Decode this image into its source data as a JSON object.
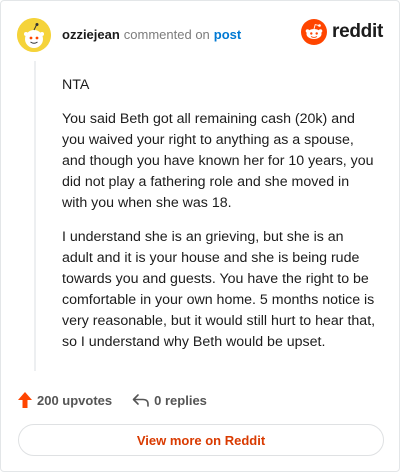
{
  "header": {
    "username": "ozziejean",
    "commented_text": "commented on",
    "post_link": "post",
    "brand": "reddit"
  },
  "comment": {
    "paragraphs": [
      "NTA",
      "You said Beth got all remaining cash (20k) and you waived your right to anything as a spouse, and though you have known her for 10 years, you did not play a fathering role and she moved in with you when she was 18.",
      "I understand she is an grieving, but she is an adult and it is your house and she is being rude towards you and guests. You have the right to be comfortable in your own home. 5 months notice is very reasonable, but it would still hurt to hear that, so I understand why Beth would be upset."
    ]
  },
  "actions": {
    "upvotes": "200 upvotes",
    "replies": "0 replies"
  },
  "footer": {
    "view_more": "View more on Reddit"
  },
  "colors": {
    "accent": "#ff4500",
    "link": "#0079d3",
    "view_more": "#d93a00"
  },
  "icons": [
    "snoo-avatar-icon",
    "reddit-logo-icon",
    "upvote-arrow-icon",
    "reply-icon"
  ]
}
